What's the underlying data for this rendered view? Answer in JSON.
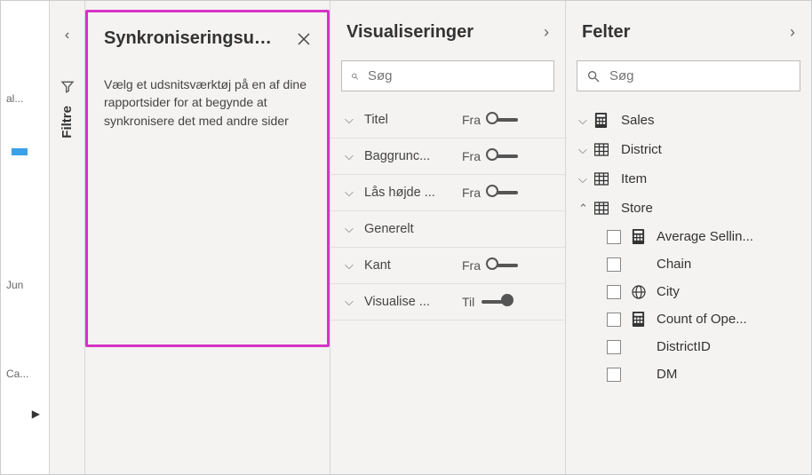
{
  "canvas": {
    "tab1": "al...",
    "tab2": "Jun",
    "tab3": "Ca..."
  },
  "filters": {
    "label": "Filtre"
  },
  "sync": {
    "title": "Synkroniseringsu…",
    "message": "Vælg et udsnitsværktøj på en af dine rapportsider for at begynde at synkronisere det med andre sider"
  },
  "visualizations": {
    "title": "Visualiseringer",
    "search_placeholder": "Søg",
    "items": [
      {
        "label": "Titel",
        "state": "Fra",
        "on": false,
        "has_toggle": true
      },
      {
        "label": "Baggrunc...",
        "state": "Fra",
        "on": false,
        "has_toggle": true
      },
      {
        "label": "Lås højde ...",
        "state": "Fra",
        "on": false,
        "has_toggle": true
      },
      {
        "label": "Generelt",
        "state": "",
        "on": false,
        "has_toggle": false
      },
      {
        "label": "Kant",
        "state": "Fra",
        "on": false,
        "has_toggle": true
      },
      {
        "label": "Visualise ...",
        "state": "Til",
        "on": true,
        "has_toggle": true
      }
    ]
  },
  "fields": {
    "title": "Felter",
    "search_placeholder": "Søg",
    "tables": [
      {
        "name": "Sales",
        "expanded": false,
        "icon": "calc"
      },
      {
        "name": "District",
        "expanded": false,
        "icon": "table"
      },
      {
        "name": "Item",
        "expanded": false,
        "icon": "table"
      },
      {
        "name": "Store",
        "expanded": true,
        "icon": "table",
        "children": [
          {
            "name": "Average Sellin...",
            "icon": "calc"
          },
          {
            "name": "Chain",
            "icon": ""
          },
          {
            "name": "City",
            "icon": "globe"
          },
          {
            "name": "Count of Ope...",
            "icon": "calc"
          },
          {
            "name": "DistrictID",
            "icon": ""
          },
          {
            "name": "DM",
            "icon": ""
          }
        ]
      }
    ]
  }
}
